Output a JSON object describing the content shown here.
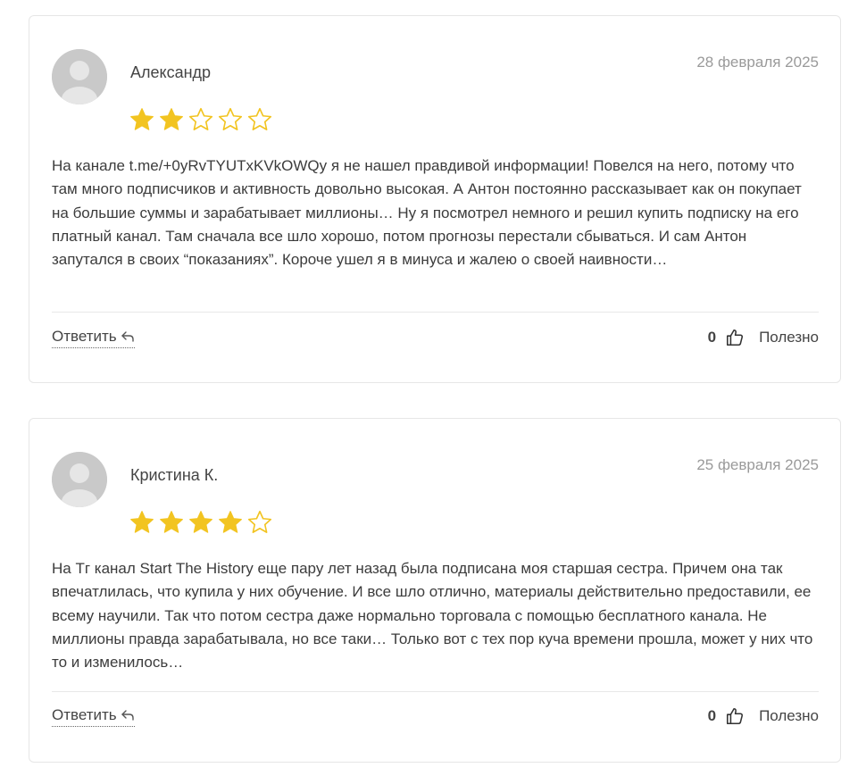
{
  "colors": {
    "star_filled": "#f2c421",
    "star_outline": "#f2c421",
    "card_border": "#e6e6e6",
    "date_text": "#9a9a9a"
  },
  "reviews": [
    {
      "author": "Александр",
      "date": "28 февраля 2025",
      "rating": 2,
      "rating_max": 5,
      "text": "На канале t.me/+0yRvTYUTxKVkOWQy я не нашел правдивой информации! Повелся на него, потому что там много подписчиков и активность довольно высокая. А Антон постоянно рассказывает как он покупает на большие суммы и зарабатывает миллионы… Ну я посмотрел немного и решил купить подписку на его платный канал. Там сначала все шло хорошо, потом прогнозы перестали сбываться. И сам Антон запутался в своих “показаниях”. Короче ушел я в минуса и жалею о своей наивности…",
      "reply_label": "Ответить",
      "helpful_count": "0",
      "helpful_label": "Полезно"
    },
    {
      "author": "Кристина К.",
      "date": "25 февраля 2025",
      "rating": 4,
      "rating_max": 5,
      "text": "На Тг канал Start The History еще пару лет назад была подписана моя старшая сестра. Причем она так впечатлилась, что купила у них обучение. И все шло отлично, материалы действительно предоставили, ее всему научили. Так что потом сестра даже нормально торговала с помощью бесплатного канала. Не миллионы правда зарабатывала, но все таки… Только вот с тех пор куча времени прошла, может у них что то и изменилось…",
      "reply_label": "Ответить",
      "helpful_count": "0",
      "helpful_label": "Полезно"
    }
  ],
  "icons": {
    "avatar": "user-avatar-icon",
    "star": "star-icon",
    "reply": "reply-arrow-icon",
    "thumb": "thumbs-up-icon"
  }
}
